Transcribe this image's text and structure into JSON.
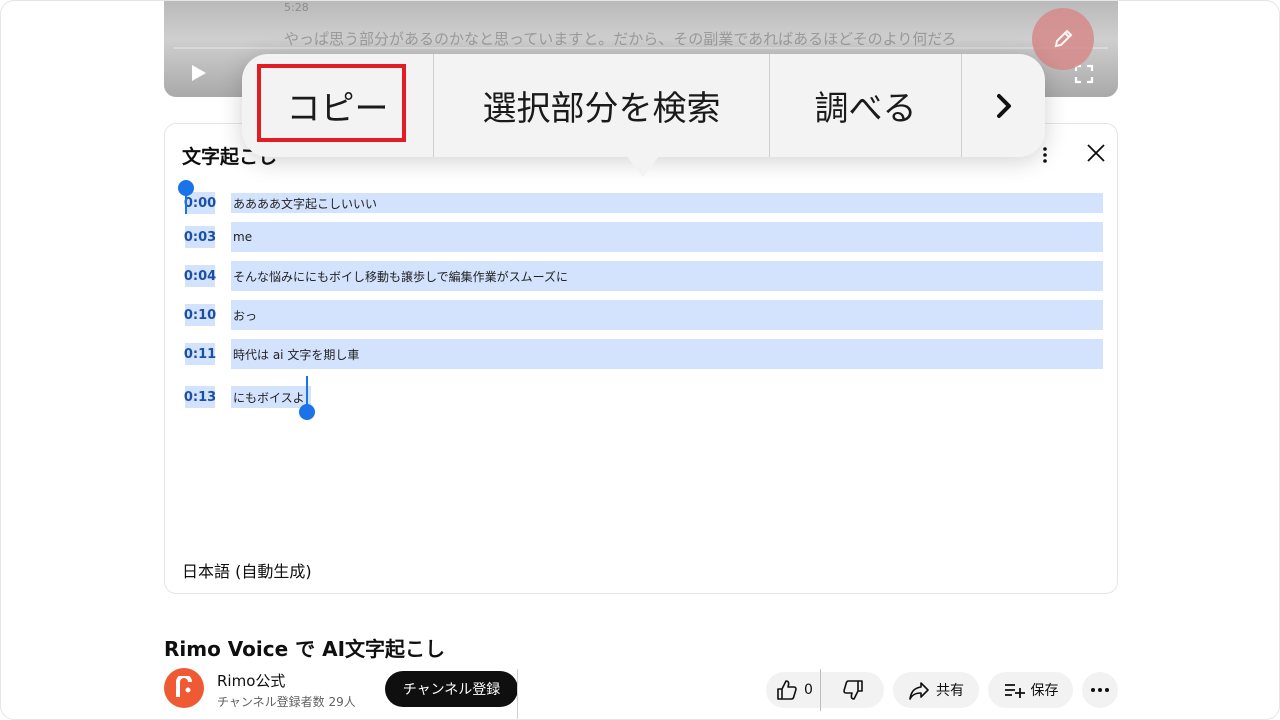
{
  "player": {
    "time": "5:28",
    "caption": "やっぱ思う部分があるのかなと思っていますと。だから、その副業であればあるほどそのより何だろ"
  },
  "context_menu": {
    "copy": "コピー",
    "search": "選択部分を検索",
    "lookup": "調べる",
    "more": "›"
  },
  "transcript": {
    "title": "文字起こし",
    "segments": [
      {
        "time": "0:00",
        "text": "ああああ文字起こしいいい"
      },
      {
        "time": "0:03",
        "text": "me"
      },
      {
        "time": "0:04",
        "text": "そんな悩みににもボイし移動も譲歩しで編集作業がスムーズに"
      },
      {
        "time": "0:10",
        "text": "おっ"
      },
      {
        "time": "0:11",
        "text": "時代は ai 文字を期し車"
      },
      {
        "time": "0:13",
        "text": "にもボイスよ"
      }
    ],
    "language": "日本語 (自動生成)"
  },
  "video": {
    "title": "Rimo Voice で AI文字起こし",
    "channel_name": "Rimo公式",
    "subscribers": "チャンネル登録者数 29人",
    "subscribe_label": "チャンネル登録",
    "like_count": "0",
    "share_label": "共有",
    "save_label": "保存"
  },
  "colors": {
    "selection": "#d3e3fd",
    "handle": "#1a73e8",
    "highlight": "#e31b23",
    "brand": "#ef5a34"
  }
}
